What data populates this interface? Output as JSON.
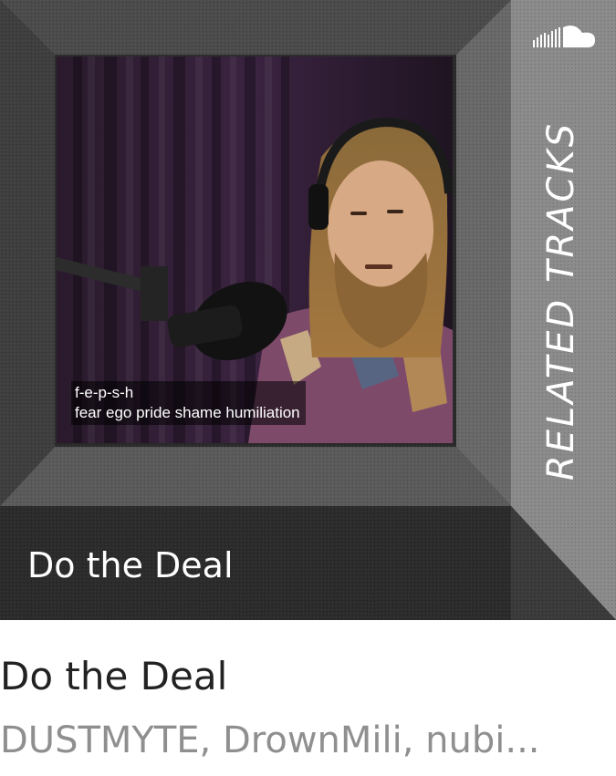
{
  "artwork": {
    "side_label": "RELATED TRACKS",
    "caption_line1": "f-e-p-s-h",
    "caption_line2": "fear ego pride shame humiliation",
    "title": "Do the Deal",
    "logo_icon": "soundcloud-icon"
  },
  "track": {
    "title": "Do the Deal",
    "artists": "DUSTMYTE, DrownMili, nubi..."
  }
}
